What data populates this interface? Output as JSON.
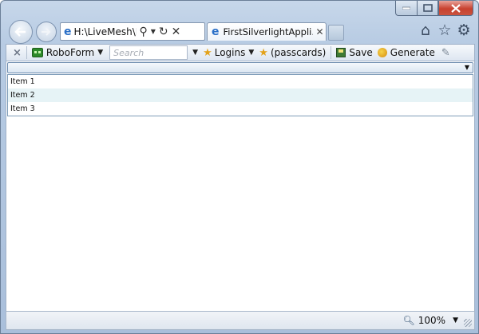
{
  "window": {
    "caption_buttons": [
      "minimize-icon",
      "maximize-icon",
      "close-icon"
    ]
  },
  "nav": {
    "back_icon": "back-arrow-icon",
    "forward_icon": "forward-arrow-icon"
  },
  "address_bar": {
    "value": "H:\\LiveMesh\\M",
    "icons": [
      "ie-icon",
      "search-icon",
      "refresh-icon",
      "stop-icon"
    ]
  },
  "tabs": [
    {
      "label": "FirstSilverlightAppli..."
    }
  ],
  "right_icons": [
    "home-icon",
    "favorites-star-icon",
    "tools-gear-icon"
  ],
  "toolbar": {
    "close_label": "×",
    "roboform_label": "RoboForm",
    "search_placeholder": "Search",
    "logins_label": "Logins",
    "passcards_label": "(passcards)",
    "save_label": "Save",
    "generate_label": "Generate"
  },
  "content": {
    "list_items": [
      "Item 1",
      "Item 2",
      "Item 3"
    ]
  },
  "status_bar": {
    "zoom_label": "100%"
  }
}
